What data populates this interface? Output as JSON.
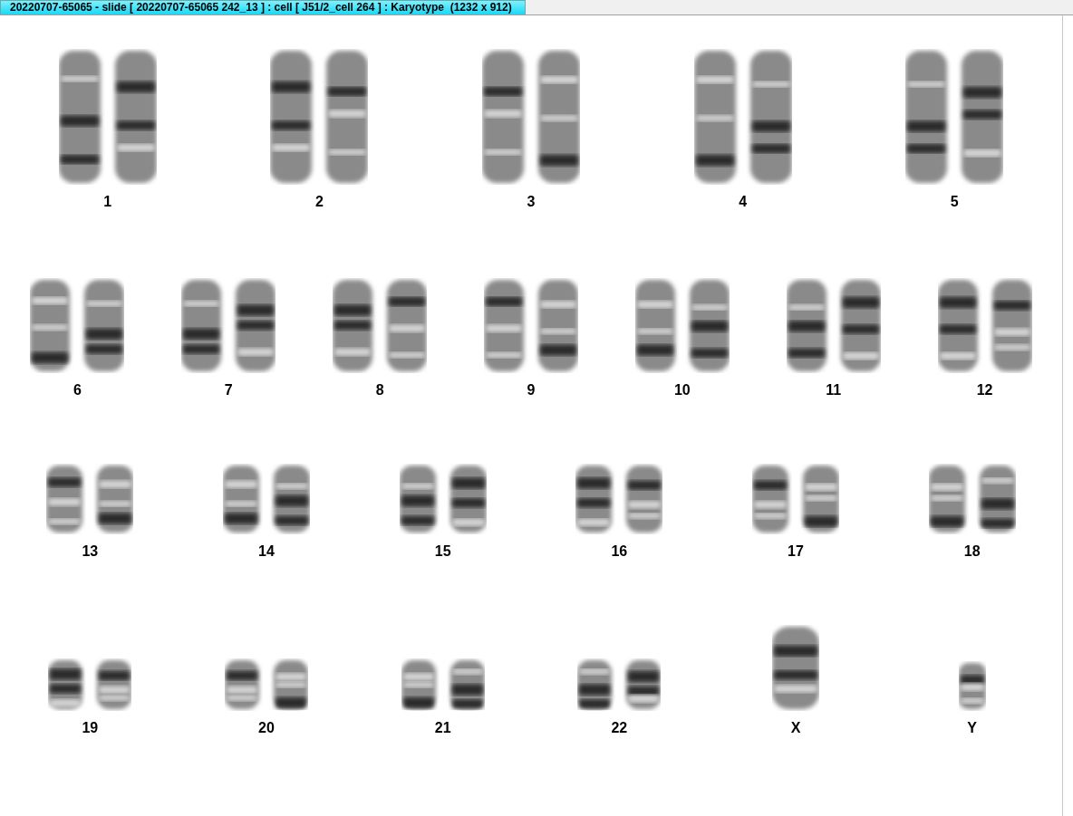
{
  "window": {
    "title": "20220707-65065 - slide [ 20220707-65065 242_13 ] : cell [ J51/2_cell 264 ] : Karyotype  (1232 x 912)"
  },
  "karyotype": {
    "rows": [
      {
        "items": [
          {
            "label": "1",
            "kind": "pair"
          },
          {
            "label": "2",
            "kind": "pair"
          },
          {
            "label": "3",
            "kind": "pair"
          },
          {
            "label": "4",
            "kind": "pair"
          },
          {
            "label": "5",
            "kind": "pair"
          }
        ]
      },
      {
        "items": [
          {
            "label": "6",
            "kind": "pair"
          },
          {
            "label": "7",
            "kind": "pair"
          },
          {
            "label": "8",
            "kind": "pair"
          },
          {
            "label": "9",
            "kind": "pair"
          },
          {
            "label": "10",
            "kind": "pair"
          },
          {
            "label": "11",
            "kind": "pair"
          },
          {
            "label": "12",
            "kind": "pair"
          }
        ]
      },
      {
        "items": [
          {
            "label": "13",
            "kind": "pair"
          },
          {
            "label": "14",
            "kind": "pair"
          },
          {
            "label": "15",
            "kind": "pair"
          },
          {
            "label": "16",
            "kind": "pair"
          },
          {
            "label": "17",
            "kind": "pair"
          },
          {
            "label": "18",
            "kind": "pair"
          }
        ]
      },
      {
        "items": [
          {
            "label": "19",
            "kind": "pair"
          },
          {
            "label": "20",
            "kind": "pair"
          },
          {
            "label": "21",
            "kind": "pair"
          },
          {
            "label": "22",
            "kind": "pair"
          },
          {
            "label": "X",
            "kind": "tall-single"
          },
          {
            "label": "Y",
            "kind": "short-single"
          }
        ]
      }
    ]
  }
}
